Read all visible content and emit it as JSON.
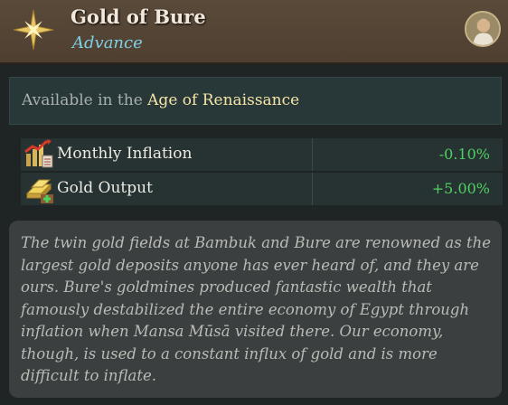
{
  "header": {
    "title": "Gold of Bure",
    "subtitle": "Advance",
    "icon": "star-icon",
    "portrait": "portrait-avatar"
  },
  "availability": {
    "prefix": "Available in the ",
    "age": "Age of Renaissance"
  },
  "modifiers": [
    {
      "label": "Monthly Inflation",
      "value": "-0.10%",
      "icon": "inflation-chart-icon"
    },
    {
      "label": "Gold Output",
      "value": "+5.00%",
      "icon": "gold-bars-icon"
    }
  ],
  "description": "The twin gold fields at Bambuk and Bure are renowned as the largest gold deposits anyone has ever heard of, and they are ours. Bure's goldmines produced fantastic wealth that famously destabilized the entire economy of Egypt through inflation when Mansa Mūsā visited there. Our economy, though, is used to a constant influx of gold and is more difficult to inflate.",
  "colors": {
    "accent": "#7fd0e6",
    "positive": "#4fd15f",
    "age": "#f4e4a6"
  }
}
